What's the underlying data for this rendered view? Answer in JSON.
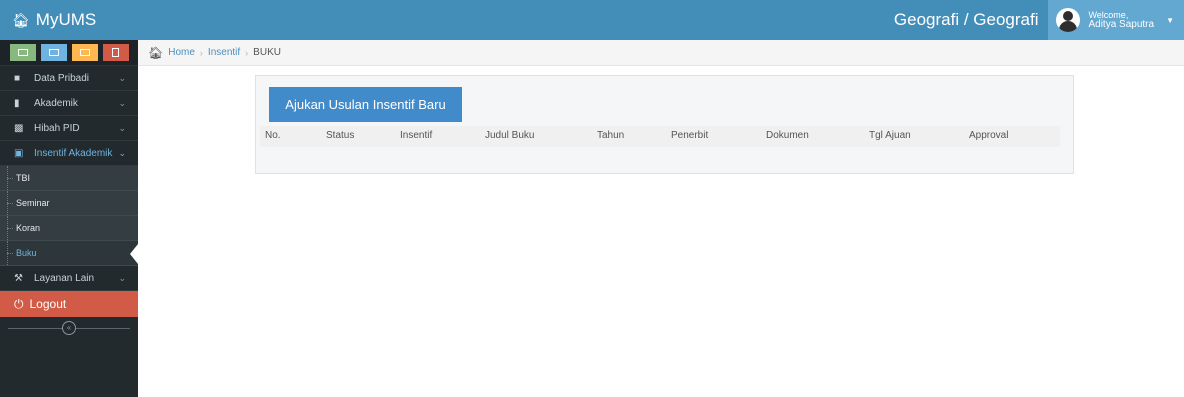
{
  "navbar": {
    "brand": "MyUMS",
    "unit_title": "Geografi / Geografi",
    "welcome_label": "Welcome,",
    "user_name": "Aditya Saputra",
    "color": "#438eb9"
  },
  "shortcuts": [
    {
      "name": "desktop-icon",
      "color": "#87b87f"
    },
    {
      "name": "list-icon",
      "color": "#6fb3e0"
    },
    {
      "name": "chart-icon",
      "color": "#ffb752"
    },
    {
      "name": "file-icon",
      "color": "#d15b47"
    }
  ],
  "sidebar": {
    "items": [
      {
        "label": "Data Pribadi",
        "icon": "user-icon"
      },
      {
        "label": "Akademik",
        "icon": "book-icon"
      },
      {
        "label": "Hibah PID",
        "icon": "briefcase-icon"
      },
      {
        "label": "Insentif Akademik",
        "icon": "money-icon"
      }
    ],
    "submenu": [
      {
        "label": "TBI"
      },
      {
        "label": "Seminar"
      },
      {
        "label": "Koran"
      },
      {
        "label": "Buku"
      }
    ],
    "after": {
      "label": "Layanan Lain",
      "icon": "wrench-icon"
    },
    "logout": "Logout"
  },
  "breadcrumb": {
    "home": "Home",
    "section": "Insentif",
    "current": "BUKU"
  },
  "main": {
    "add_button": "Ajukan Usulan Insentif Baru",
    "columns": [
      "No.",
      "Status",
      "Insentif",
      "Judul Buku",
      "Tahun",
      "Penerbit",
      "Dokumen",
      "Tgl Ajuan",
      "Approval"
    ]
  }
}
